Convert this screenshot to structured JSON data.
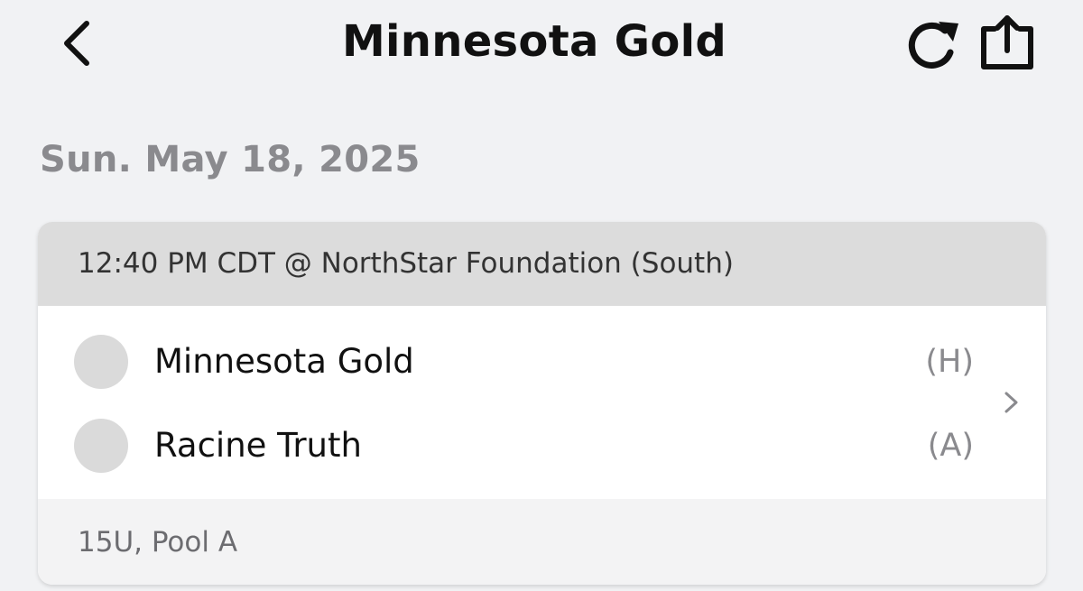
{
  "header": {
    "title": "Minnesota Gold",
    "back_icon": "chevron-left-icon",
    "refresh_icon": "refresh-icon",
    "share_icon": "share-icon"
  },
  "schedule": {
    "date": "Sun. May 18, 2025",
    "games": [
      {
        "time_location": "12:40 PM CDT @ NorthStar Foundation (South)",
        "home_team": {
          "name": "Minnesota Gold",
          "side": "(H)"
        },
        "away_team": {
          "name": "Racine Truth",
          "side": "(A)"
        },
        "division": "15U, Pool A"
      }
    ]
  },
  "colors": {
    "background": "#f1f2f4",
    "card_header": "#dcdcdc",
    "muted_text": "#8a8a8e",
    "logo_placeholder": "#dadada"
  }
}
